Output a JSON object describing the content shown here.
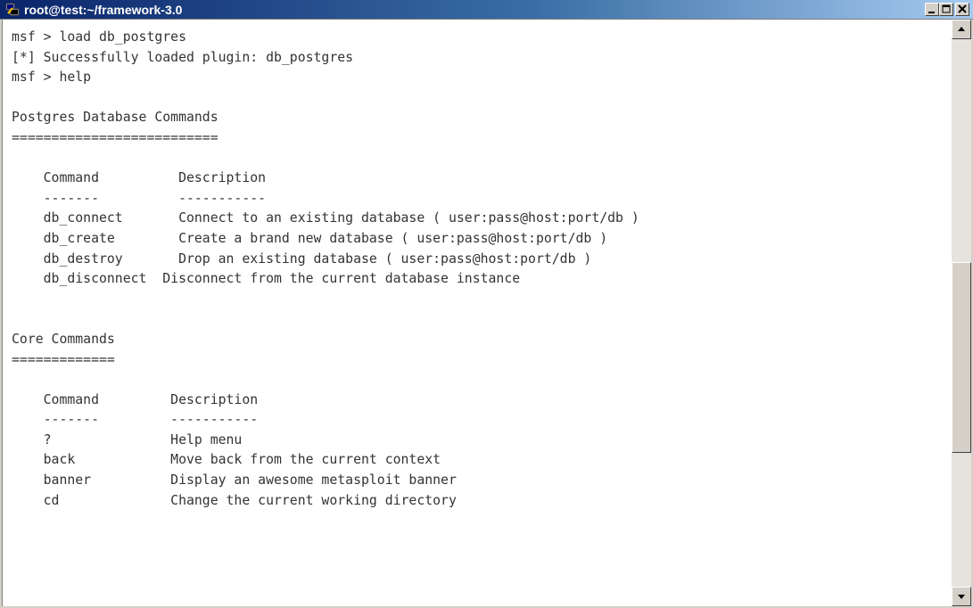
{
  "window": {
    "title": "root@test:~/framework-3.0",
    "icon": "putty-terminal-icon"
  },
  "controls": {
    "minimize": "minimize-icon",
    "maximize": "maximize-icon",
    "close": "close-icon"
  },
  "terminal": {
    "lines": [
      "msf > load db_postgres",
      "[*] Successfully loaded plugin: db_postgres",
      "msf > help",
      "",
      "Postgres Database Commands",
      "==========================",
      "",
      "    Command          Description",
      "    -------          -----------",
      "    db_connect       Connect to an existing database ( user:pass@host:port/db )",
      "    db_create        Create a brand new database ( user:pass@host:port/db )",
      "    db_destroy       Drop an existing database ( user:pass@host:port/db )",
      "    db_disconnect  Disconnect from the current database instance",
      "",
      "",
      "Core Commands",
      "=============",
      "",
      "    Command         Description",
      "    -------         -----------",
      "    ?               Help menu",
      "    back            Move back from the current context",
      "    banner          Display an awesome metasploit banner",
      "    cd              Change the current working directory"
    ]
  },
  "scrollbar": {
    "up": "scroll-up-arrow-icon",
    "down": "scroll-down-arrow-icon"
  }
}
